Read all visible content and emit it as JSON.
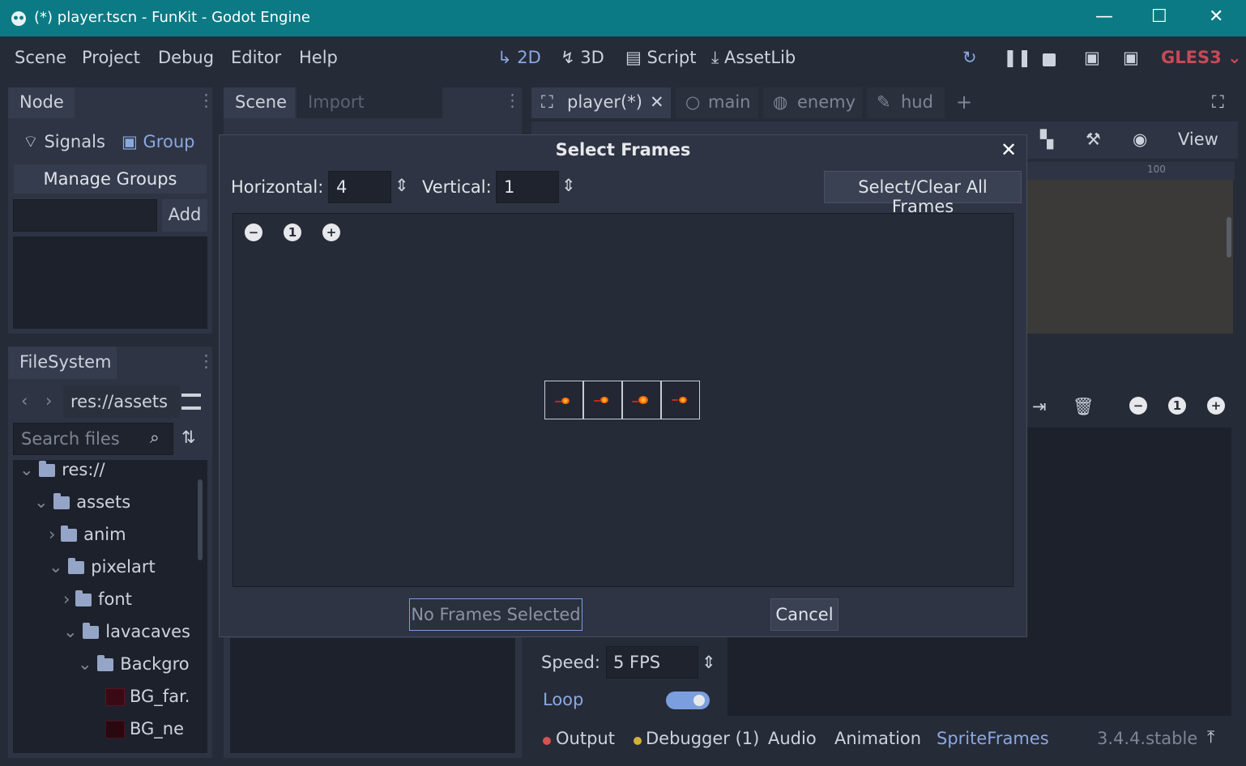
{
  "window": {
    "title": "(*) player.tscn - FunKit - Godot Engine",
    "minimize": "—",
    "maximize": "☐",
    "close": "✕"
  },
  "menu": {
    "items": [
      "Scene",
      "Project",
      "Debug",
      "Editor",
      "Help"
    ],
    "modes": [
      "2D",
      "3D",
      "Script",
      "AssetLib"
    ],
    "renderer": "GLES3"
  },
  "node_panel": {
    "tab": "Node",
    "signals": "Signals",
    "group": "Group",
    "manage_groups": "Manage Groups",
    "add": "Add"
  },
  "scene_panel": {
    "tabs": [
      "Scene",
      "Import"
    ]
  },
  "filesystem": {
    "tab": "FileSystem",
    "path": "res://assets",
    "search_placeholder": "Search files",
    "tree": [
      "res://",
      "assets",
      "anim",
      "pixelart",
      "font",
      "lavacaves",
      "Backgro",
      "BG_far.",
      "BG_ne"
    ]
  },
  "editor_tabs": {
    "tabs": [
      "player(*)",
      "main",
      "enemy",
      "hud"
    ],
    "view": "View",
    "ruler_100": "100"
  },
  "dialog": {
    "title": "Select Frames",
    "horizontal_label": "Horizontal:",
    "horizontal_value": "4",
    "vertical_label": "Vertical:",
    "vertical_value": "1",
    "select_clear": "Select/Clear All Frames",
    "zoom_out": "−",
    "zoom_reset": "1",
    "zoom_in": "+",
    "no_frames": "No Frames Selected",
    "cancel": "Cancel",
    "close": "✕"
  },
  "sprite_frames": {
    "speed_label": "Speed:",
    "speed_value": "5 FPS",
    "loop_label": "Loop"
  },
  "bottom_bar": {
    "output": "Output",
    "debugger": "Debugger (1)",
    "audio": "Audio",
    "animation": "Animation",
    "sprite_frames": "SpriteFrames",
    "version": "3.4.4.stable"
  },
  "colors": {
    "titlebar": "#0b7a84",
    "accent": "#8aa8e0",
    "renderer": "#c64a56",
    "output_dot": "#d9534f",
    "debugger_dot": "#d4b03a",
    "toggle": "#7b9ede"
  }
}
